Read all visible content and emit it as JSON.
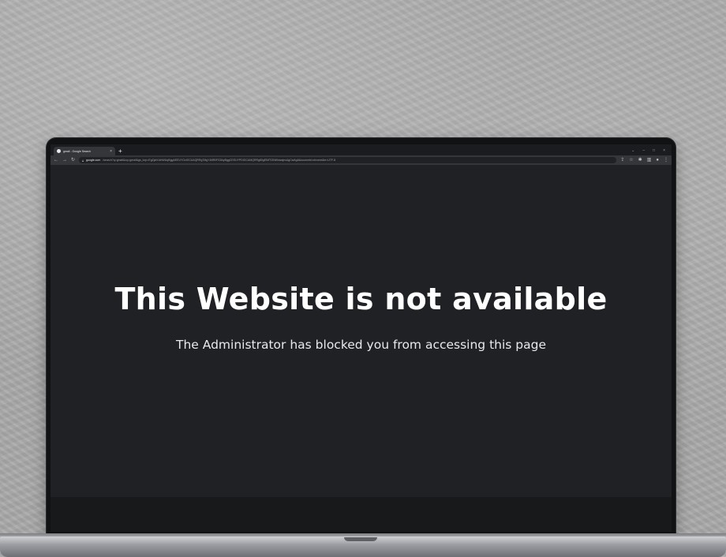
{
  "browser": {
    "tab_title": "gmail - Google Search",
    "tab_close": "×",
    "new_tab": "+",
    "window_controls": {
      "chevron": "⌄",
      "minimize": "–",
      "maximize": "□",
      "close": "×"
    },
    "toolbar": {
      "back": "←",
      "forward": "→",
      "reload": "↻"
    },
    "url_host": "google.com",
    "url_rest": "/search?q=gmail&oq=gmail&gs_lcrp=EgZjaHJvbWUqBggAEEUYOzIGCAAQRRg7MgYIARBFGDkyBggCEEUYPDIGCAMQRRg80gEIMTI3NWowajeoAgCwAgA&sourceid=chrome&ie=UTF-8"
  },
  "page": {
    "headline": "This Website is not available",
    "message": "The Administrator has blocked you from accessing this page"
  },
  "colors": {
    "page_background": "#202125",
    "headline": "#ffffff",
    "wall": "#a9a9a9"
  }
}
